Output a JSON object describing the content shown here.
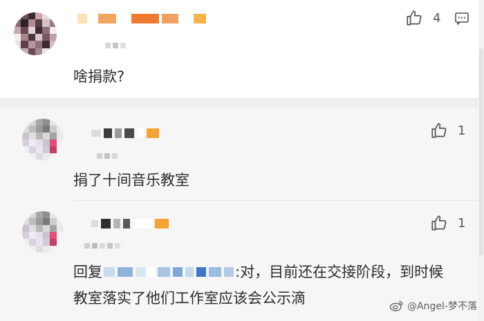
{
  "comments": [
    {
      "text": "啥捐款?",
      "likes": "4"
    },
    {
      "text": "捐了十间音乐教室",
      "likes": "1"
    },
    {
      "reply_prefix": "回复",
      "reply_suffix": ":对，目前还在交接阶段，到时候",
      "reply_line2": "教室落实了他们工作室应该会公示滴",
      "likes": "1"
    }
  ],
  "watermark": {
    "text": "@Angel-梦不落"
  },
  "icons": {
    "like": "thumbs-up-icon",
    "reply": "comment-bubble-icon",
    "weibo": "weibo-logo-icon"
  },
  "colors": {
    "divider": "#efefef",
    "reply_bg": "#f6f6f6",
    "text": "#2b2b2b"
  }
}
